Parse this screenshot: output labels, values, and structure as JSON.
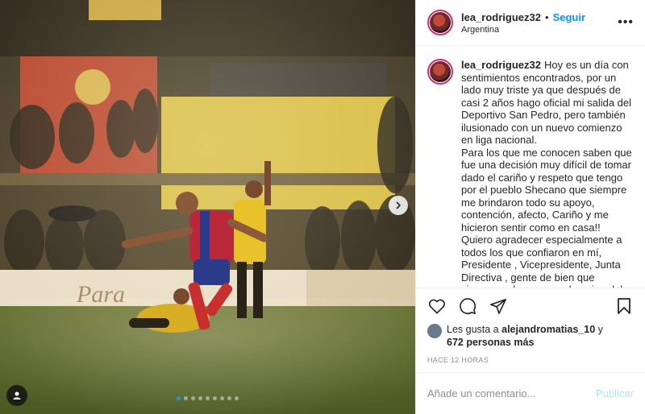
{
  "header": {
    "username": "lea_rodriguez32",
    "separator": "•",
    "follow_label": "Seguir",
    "location": "Argentina",
    "more_icon": "more-horizontal-icon"
  },
  "caption": {
    "username": "lea_rodriguez32",
    "paragraphs": [
      "Hoy es un día con sentimientos encontrados, por un lado muy triste ya que después de casi 2 años hago oficial mi salida del Deportivo San Pedro, pero también ilusionado con un nuevo comienzo en liga nacional.",
      "Para los que me conocen saben que fue una decisión muy difícil de tomar dado el cariño y respeto que tengo por el pueblo Shecano que siempre me brindaron todo su apoyo, contención, afecto, Cariño y me hicieron sentir como en casa!!",
      "Quiero agradecer especialmente a todos los que confiaron en mí, Presidente , Vicepresidente, Junta Directiva , gente de bien que siempre pelearon por el equipo del pueblo"
    ]
  },
  "media": {
    "carousel_total": 9,
    "carousel_active": 1,
    "next_icon": "chevron-right-icon",
    "tag_icon": "user-tag-icon"
  },
  "actions": {
    "like_icon": "heart-icon",
    "comment_icon": "comment-icon",
    "share_icon": "send-icon",
    "save_icon": "bookmark-icon"
  },
  "likes": {
    "prefix": "Les gusta a",
    "user": "alejandromatias_10",
    "joiner": "y",
    "others": "672 personas más"
  },
  "timestamp": "HACE 12 HORAS",
  "comment": {
    "placeholder": "Añade un comentario...",
    "publish_label": "Publicar"
  },
  "colors": {
    "link_blue": "#0095f6",
    "publish_disabled": "#b2dffc",
    "muted": "#8e8e8e",
    "story_ring": "#d62976",
    "carousel_active_dot": "#1f9ad8"
  }
}
